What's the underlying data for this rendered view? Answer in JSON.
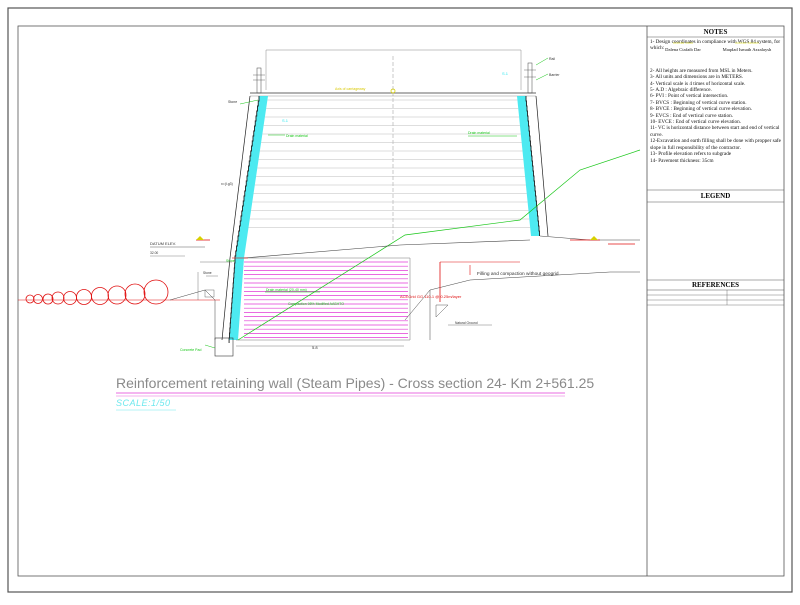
{
  "drawing": {
    "title": "Reinforcement retaining wall (Steam Pipes) - Cross section 24- Km 2+561.25",
    "scale": "SCALE:1/50"
  },
  "notes": {
    "title": "NOTES",
    "items": [
      "1- Design coordinates in compliance with WGS 84 system, for which:",
      "2- All heights are measured from MSL in Meters.",
      "3- All units and dimensions are in METERS.",
      "4- Vertical scale is 4 times of horizontal scale.",
      "5- A.D : Algebraic difference.",
      "6- PVI : Point of vertical intersection.",
      "7- BVCS : Beginning of vertical curve station.",
      "8- BVCE : Beginning of vertical curve elevation.",
      "9- EVCS : End of vertical curve station.",
      "10- EVCE : End of vertical curve elevation.",
      "11- VC is horizontal distance between start and end of vertical curve.",
      "12-Excavation and earth filling shall be done with propper safe slope in full responsibility of the contractor.",
      "13- Profile elevation refers to subgrade",
      "14- Pavement thickness: 35cm"
    ],
    "signatures": [
      {
        "name": "Dalena Ctafaib Dar"
      },
      {
        "name": "Maqdad Ismath Azzalaysh"
      }
    ]
  },
  "legend": {
    "title": "LEGEND"
  },
  "references": {
    "title": "REFERENCES"
  },
  "annotations": {
    "filling": "Filling and compaction without geogrid",
    "acegrid": "ACEGrid GG 110-1 @ 0.25m/layer",
    "compaction": "Compaction 98% Modified AASHTO",
    "datum": "DATUM ELEV.",
    "drain_left": "Drain material",
    "drain_right": "Drain material",
    "drain_lower": "Drain material (20-40 mm)",
    "concrete_pad": "Concrete Pad",
    "bottom_dim": "5.8",
    "slope_label": "S.1",
    "slope_label_right": "S.1",
    "natural_ground": "Natural Ground",
    "rail": "Rail",
    "barrier": "Barrier",
    "stone": "Stone"
  },
  "colors": {
    "drain": "#2ee6ee",
    "geogrid": "#e23ad6",
    "ground": "#17c617",
    "accent_red": "#e01010",
    "note_yellow": "#e0d000",
    "line": "#333333"
  }
}
